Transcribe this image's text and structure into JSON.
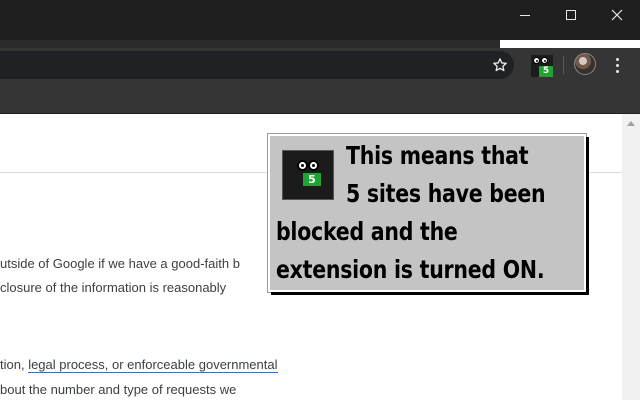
{
  "window_controls": {
    "minimize": "minimize-icon",
    "maximize": "maximize-icon",
    "close": "close-icon"
  },
  "toolbar": {
    "bookmark_icon": "star-icon",
    "extension": {
      "icon": "ad-blocker-extension-icon",
      "badge_count": "5",
      "badge_color": "#21a334"
    },
    "profile_icon": "avatar",
    "menu_icon": "more-vert-icon"
  },
  "page": {
    "lines": [
      "utside of Google if we have a good-faith b",
      "closure of the information is reasonably",
      "tion, ",
      "bout the number and type of requests we"
    ],
    "link_text": "legal process, or enforceable governmental"
  },
  "callout": {
    "lines": [
      "This means that",
      "5 sites have been",
      "blocked and the",
      "extension is turned ON."
    ],
    "icon": "ad-blocker-extension-icon",
    "badge_count": "5"
  },
  "colors": {
    "titlebar": "#1f1f1f",
    "toolbar": "#353535",
    "callout_bg": "#c4c4c4",
    "badge": "#21a334"
  }
}
